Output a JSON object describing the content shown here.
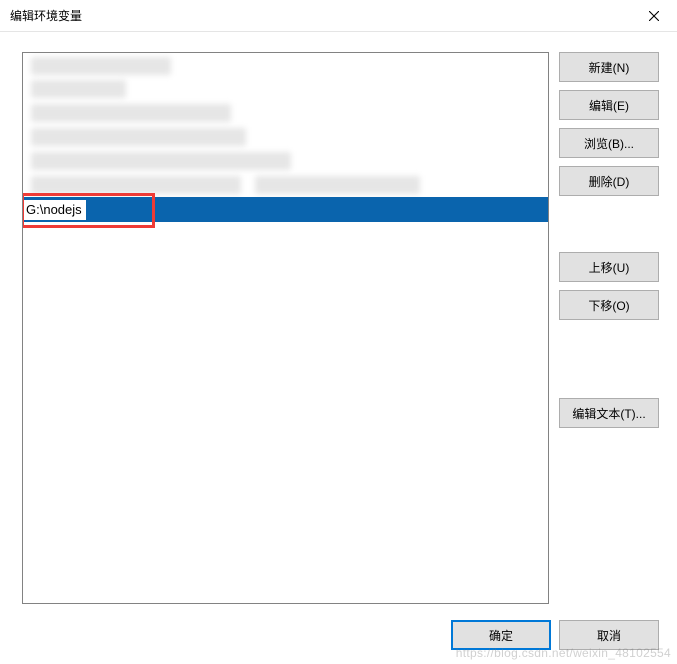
{
  "title": "编辑环境变量",
  "editing_value": "G:\\nodejs",
  "buttons": {
    "new": "新建(N)",
    "edit": "编辑(E)",
    "browse": "浏览(B)...",
    "delete": "删除(D)",
    "move_up": "上移(U)",
    "move_down": "下移(O)",
    "edit_text": "编辑文本(T)...",
    "ok": "确定",
    "cancel": "取消"
  },
  "watermark": "https://blog.csdn.net/weixin_48102554"
}
